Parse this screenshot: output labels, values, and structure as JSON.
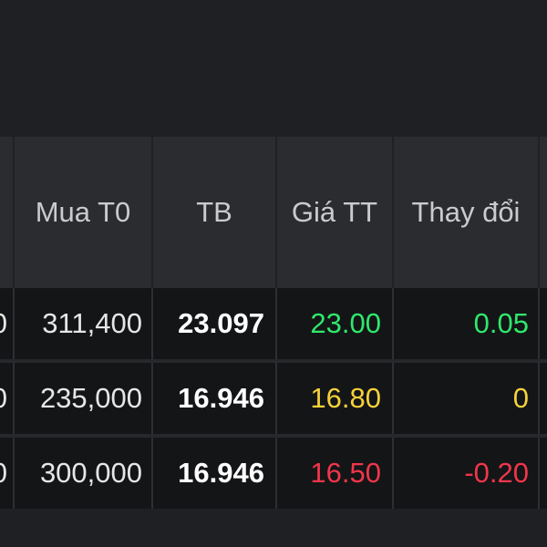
{
  "table": {
    "headers": {
      "col0": "",
      "mua_t0": "Mua T0",
      "tb": "TB",
      "gia_tt": "Giá TT",
      "thay_doi": "Thay đổi"
    },
    "rows": [
      {
        "prev_partial": "0",
        "mua_t0": "311,400",
        "tb": "23.097",
        "gia_tt": "23.00",
        "thay_doi": "0.05",
        "status": "up"
      },
      {
        "prev_partial": "0",
        "mua_t0": "235,000",
        "tb": "16.946",
        "gia_tt": "16.80",
        "thay_doi": "0",
        "status": "reference"
      },
      {
        "prev_partial": "0",
        "mua_t0": "300,000",
        "tb": "16.946",
        "gia_tt": "16.50",
        "thay_doi": "-0.20",
        "status": "down"
      }
    ]
  },
  "colors": {
    "up": "#2ee86b",
    "reference": "#f5d23a",
    "down": "#f0364a",
    "background": "#1e2023",
    "header_background": "#2a2c30",
    "row_background": "#141517"
  }
}
